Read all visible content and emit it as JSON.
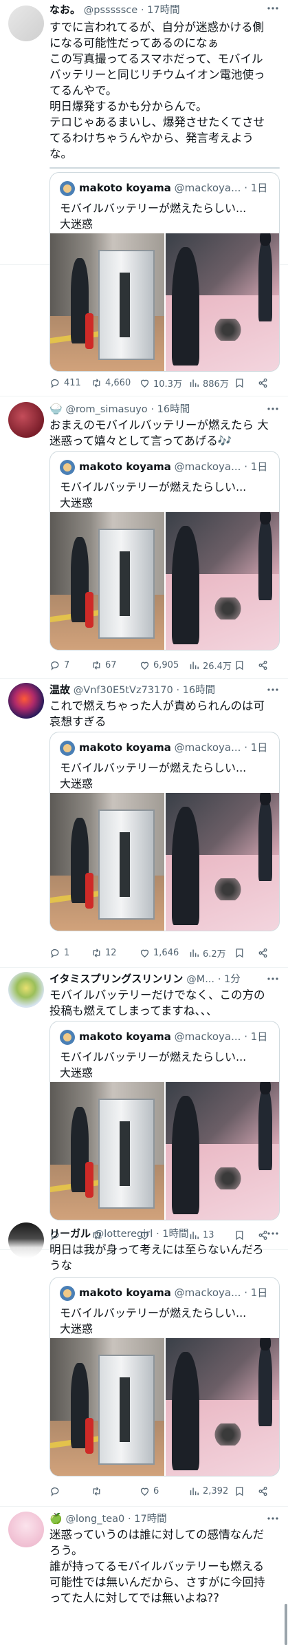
{
  "quoted": {
    "name": "makoto koyama",
    "handle": "@mackoya...",
    "time": "· 1日",
    "text": "モバイルバッテリーが燃えたらしい...\n大迷惑"
  },
  "replies": [
    {
      "name": "なお。",
      "handle": "@psssssce",
      "time": "· 17時間",
      "text": "すでに言われてるが、自分が迷惑かける側\nになる可能性だってあるのになぁ\nこの写真撮ってるスマホだって、モバイル\nバッテリーと同じリチウムイオン電池使っ\nてるんやで。\n明日爆発するかも分からんで。\nテロじゃあるまいし、爆発させたくてさせ\nてるわけちゃうんやから、発言考えよう\nな。",
      "stats": {
        "replies": "411",
        "reposts": "4,660",
        "likes": "10.3万",
        "views": "886万"
      }
    },
    {
      "name": "",
      "emoji": "🍚",
      "handle": "@rom_simasuyo",
      "time": "· 16時間",
      "text": "おまえのモバイルバッテリーが燃えたら 大\n迷惑って嬉々として言ってあげる🎶",
      "stats": {
        "replies": "7",
        "reposts": "67",
        "likes": "6,905",
        "views": "26.4万"
      }
    },
    {
      "name": "温故",
      "handle": "@Vnf30E5tVz73170",
      "time": "· 16時間",
      "text": "これで燃えちゃった人が責められんのは可\n哀想すぎる",
      "stats": {
        "replies": "1",
        "reposts": "12",
        "likes": "1,646",
        "views": "6.2万"
      }
    },
    {
      "name": "イタミスプリングスリンリン",
      "handle": "@M...",
      "time": "· 1分",
      "text": "モバイルバッテリーだけでなく、この方の\n投稿も燃えてしまってますね、、、",
      "stats": {
        "replies": "",
        "reposts": "",
        "likes": "",
        "views": "13"
      }
    },
    {
      "name": "リーガル",
      "handle": "@lotteregirl",
      "time": "· 1時間",
      "text": "明日は我が身って考えには至らないんだろ\nうな",
      "stats": {
        "replies": "",
        "reposts": "",
        "likes": "6",
        "views": "2,392"
      }
    },
    {
      "name": "",
      "emoji": "🍏",
      "handle": "@long_tea0",
      "time": "· 17時間",
      "text": "迷惑っていうのは誰に対しての感情なんだ\nろう。\n誰が持ってるモバイルバッテリーも燃える\n可能性では無いんだから、さすがに今回持\nってた人に対してでは無いよね??",
      "stats": null
    }
  ],
  "colors": {
    "text": "#0f1419",
    "secondary": "#536471",
    "border": "#cfd9de",
    "divider": "#eff3f4"
  },
  "icons": [
    "reply-icon",
    "repost-icon",
    "like-icon",
    "views-icon",
    "bookmark-icon",
    "share-icon",
    "more-icon"
  ]
}
